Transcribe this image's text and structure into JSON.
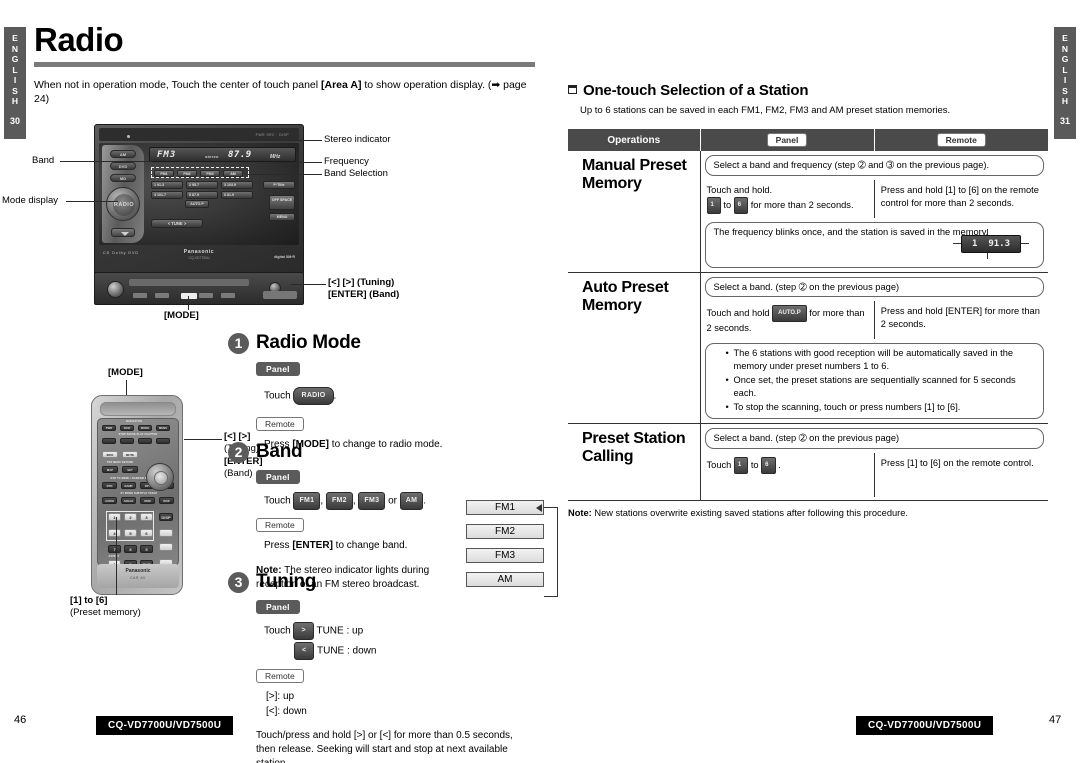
{
  "lang_tabs": {
    "left": {
      "label": "ENGLISH",
      "page": "30"
    },
    "right": {
      "label": "ENGLISH",
      "page": "31"
    }
  },
  "header": {
    "title": "Radio",
    "intro_pre": "When not in operation mode, Touch the center of touch panel ",
    "intro_bold": "[Area A]",
    "intro_post": " to show operation display. (➡ page 24)"
  },
  "device": {
    "top_text": "PWR   SRC · DISP",
    "lcd": {
      "band": "FM3",
      "stereo": "stereo",
      "frequency": "87.9",
      "unit": "MHz"
    },
    "source_buttons": [
      "AM",
      "DVD",
      "MD"
    ],
    "mode_knob": "RADIO",
    "band_select": [
      "FM1",
      "FM2",
      "FM3",
      "AM"
    ],
    "presets": [
      {
        "n": "1",
        "f": "91.3"
      },
      {
        "n": "2",
        "f": "95.7"
      },
      {
        "n": "3",
        "f": "103.9"
      },
      {
        "n": "4",
        "f": "101.7"
      },
      {
        "n": "5",
        "f": "87.9"
      },
      {
        "n": "6",
        "f": "81.9"
      }
    ],
    "auto_p": "AUTO.P",
    "right_buttons": [
      "P·Title",
      "OFF SPACE",
      "MENU"
    ],
    "tune_bar": "<  TUNE  >",
    "brand": "Panasonic",
    "model": "CQ-VD7700U",
    "logos": "CD  Dolby  DVD",
    "xm": "digital XM·R"
  },
  "callouts": {
    "stereo_indicator": "Stereo indicator",
    "frequency": "Frequency",
    "band_selection": "Band Selection",
    "band": "Band",
    "mode_display": "Mode display",
    "tuning_keys": "[<] [>] (Tuning)",
    "enter_band": "[ENTER] (Band)",
    "mode_label": "[MODE]"
  },
  "remote": {
    "mode_label": "[MODE]",
    "tuning_label_1": "[<] [>]",
    "tuning_label_2": "(Tuning)",
    "enter_label_1": "[ENTER]",
    "enter_label_2": "(Band)",
    "preset_label_1": "[1] to [6]",
    "preset_label_2": "(Preset memory)",
    "brand": "Panasonic",
    "sub": "CAR AV",
    "rows": [
      [
        "PWR",
        "NAVI",
        "MODE",
        "MENU"
      ],
      [
        "■",
        "▐▐",
        "▶",
        "DISC"
      ],
      [
        "INFO",
        "MUTE"
      ],
      [
        "MAP",
        "SET"
      ],
      [
        "RTN",
        "BAND",
        "RPT",
        "PAGE"
      ],
      [
        "AUDIO",
        "ANGLE",
        "RDM",
        "DISP"
      ]
    ],
    "row_labels": [
      "NAVIGATOR",
      "STOP  PAUSE  PLAY  CHAPTER",
      "TOP MENU   RETURN",
      "DVD TO MENU / RANDOM   REPEAT   SCROLL",
      "ST MONO   SUBTITLE   TRACK"
    ],
    "numbers": [
      "1",
      "2",
      "3",
      "4",
      "5",
      "6",
      "7",
      "8",
      "9",
      "A",
      "0",
      "ENT"
    ],
    "side_keys": [
      "DISP",
      "VOL +",
      "VOL -",
      "MUTE"
    ]
  },
  "steps": [
    {
      "num": "1",
      "title": "Radio Mode",
      "panel_badge": "Panel",
      "panel_pre": "Touch ",
      "panel_key": "RADIO",
      "panel_post": ".",
      "remote_badge": "Remote",
      "remote_pre": "Press ",
      "remote_key": "[MODE]",
      "remote_post": " to change to radio mode."
    },
    {
      "num": "2",
      "title": "Band",
      "panel_badge": "Panel",
      "panel_pre": "Touch ",
      "panel_keys": [
        "FM1",
        "FM2",
        "FM3",
        "AM"
      ],
      "panel_or": " or ",
      "panel_post": ".",
      "remote_badge": "Remote",
      "remote_pre": "Press ",
      "remote_key": "[ENTER]",
      "remote_post": " to change band.",
      "note_label": "Note:",
      "note_text": " The stereo indicator lights during reception of an FM stereo broadcast."
    },
    {
      "num": "3",
      "title": "Tuning",
      "panel_badge": "Panel",
      "touch_label": "Touch",
      "tune_up_key": ">",
      "tune_up_text": "TUNE : up",
      "tune_down_key": "<",
      "tune_down_text": "TUNE : down",
      "remote_badge": "Remote",
      "remote_up": "[>]: up",
      "remote_down": "[<]: down",
      "body": "Touch/press and hold [>] or [<] for more than 0.5 seconds, then release. Seeking will start and stop at next available station."
    }
  ],
  "band_flow": [
    "FM1",
    "FM2",
    "FM3",
    "AM"
  ],
  "right": {
    "heading": "One-touch Selection of a Station",
    "subheading": "Up to 6 stations can be saved in each FM1, FM2, FM3 and AM preset station memories.",
    "table_headers": [
      "Operations",
      "Panel",
      "Remote"
    ],
    "rows": [
      {
        "name": "Manual Preset Memory",
        "full_note": "Select a band and frequency (step ➁ and ➂ on the previous page).",
        "panel_line1": "Touch and hold.",
        "panel_line2_pre": "",
        "panel_key_a": "1",
        "panel_mid": " to ",
        "panel_key_b": "6",
        "panel_line2_post": " for more than 2 seconds.",
        "remote": "Press and hold [1] to [6] on the remote control for more than 2 seconds.",
        "result_note": "The frequency blinks once, and the station is saved in the memory.",
        "chip_num": "1",
        "chip_freq": "91.3"
      },
      {
        "name": "Auto Preset Memory",
        "full_note": "Select a band. (step ➁ on the previous page)",
        "panel_line1_pre": "Touch and hold ",
        "panel_key_a": "AUTO.P",
        "panel_line1_post": " for more than 2 seconds.",
        "remote": "Press and hold [ENTER] for more than 2 seconds.",
        "bullets": [
          "The 6 stations with good reception will be automatically saved in the memory under preset numbers 1 to 6.",
          "Once set, the preset stations are sequentially scanned for 5 seconds each.",
          "To stop the scanning, touch or press numbers [1] to [6]."
        ]
      },
      {
        "name": "Preset Station Calling",
        "full_note": "Select a band. (step ➁ on the previous page)",
        "panel_line1_pre": "Touch ",
        "panel_key_a": "1",
        "panel_mid": " to ",
        "panel_key_b": "6",
        "panel_line1_post": " .",
        "remote": "Press [1] to [6] on the remote control."
      }
    ],
    "footer_note_label": "Note:",
    "footer_note_text": " New stations overwrite existing saved stations after following this procedure."
  },
  "footer": {
    "left_model": "CQ-VD7700U/VD7500U",
    "left_page": "46",
    "right_model": "CQ-VD7700U/VD7500U",
    "right_page": "47"
  }
}
